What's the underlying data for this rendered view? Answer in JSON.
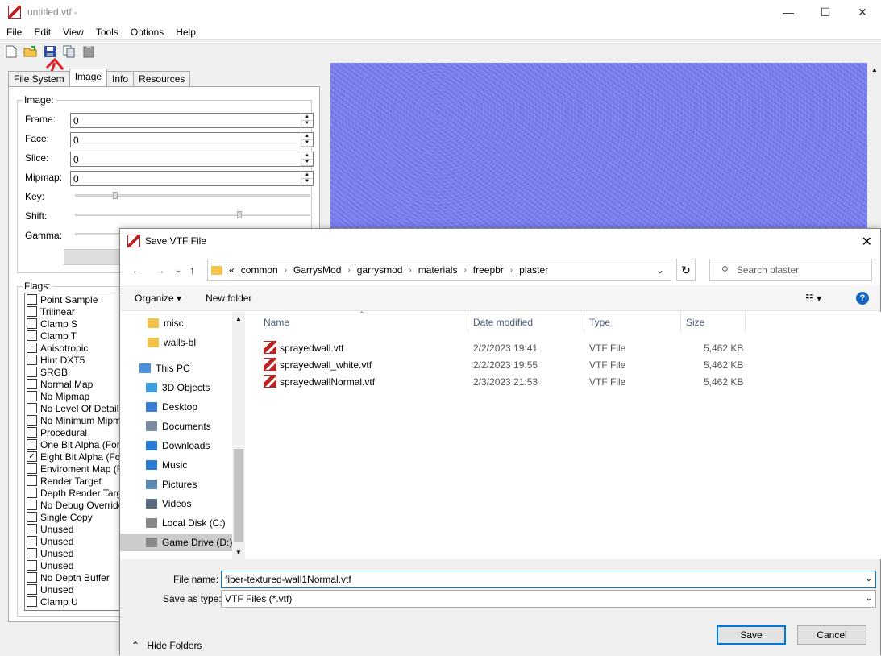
{
  "window": {
    "title": "untitled.vtf -",
    "controls": [
      "—",
      "☐",
      "✕"
    ]
  },
  "menu": [
    "File",
    "Edit",
    "View",
    "Tools",
    "Options",
    "Help"
  ],
  "tabs": [
    "File System",
    "Image",
    "Info",
    "Resources"
  ],
  "image_group": {
    "label": "Image:",
    "fields": [
      {
        "label": "Frame:",
        "value": "0"
      },
      {
        "label": "Face:",
        "value": "0"
      },
      {
        "label": "Slice:",
        "value": "0"
      },
      {
        "label": "Mipmap:",
        "value": "0"
      }
    ],
    "sliders": [
      {
        "label": "Key:",
        "level": 0.16
      },
      {
        "label": "Shift:",
        "level": 0.7
      },
      {
        "label": "Gamma:",
        "level": 0.2
      }
    ]
  },
  "flags": {
    "label": "Flags:",
    "items": [
      {
        "label": "Point Sample",
        "checked": false
      },
      {
        "label": "Trilinear",
        "checked": false
      },
      {
        "label": "Clamp S",
        "checked": false
      },
      {
        "label": "Clamp T",
        "checked": false
      },
      {
        "label": "Anisotropic",
        "checked": false
      },
      {
        "label": "Hint DXT5",
        "checked": false
      },
      {
        "label": "SRGB",
        "checked": false
      },
      {
        "label": "Normal Map",
        "checked": false
      },
      {
        "label": "No Mipmap",
        "checked": false
      },
      {
        "label": "No Level Of Detail",
        "checked": false
      },
      {
        "label": "No Minimum Mipmap",
        "checked": false
      },
      {
        "label": "Procedural",
        "checked": false
      },
      {
        "label": "One Bit Alpha (Format)",
        "checked": false
      },
      {
        "label": "Eight Bit Alpha (Format)",
        "checked": true
      },
      {
        "label": "Enviroment Map (Format)",
        "checked": false
      },
      {
        "label": "Render Target",
        "checked": false
      },
      {
        "label": "Depth Render Target",
        "checked": false
      },
      {
        "label": "No Debug Override",
        "checked": false
      },
      {
        "label": "Single Copy",
        "checked": false
      },
      {
        "label": "Unused",
        "checked": false
      },
      {
        "label": "Unused",
        "checked": false
      },
      {
        "label": "Unused",
        "checked": false
      },
      {
        "label": "Unused",
        "checked": false
      },
      {
        "label": "No Depth Buffer",
        "checked": false
      },
      {
        "label": "Unused",
        "checked": false
      },
      {
        "label": "Clamp U",
        "checked": false
      }
    ]
  },
  "dialog": {
    "title": "Save VTF File",
    "breadcrumb": [
      "«",
      "common",
      "GarrysMod",
      "garrysmod",
      "materials",
      "freepbr",
      "plaster"
    ],
    "search_placeholder": "Search plaster",
    "organize": "Organize ▾",
    "new_folder": "New folder",
    "nav": [
      {
        "label": "misc",
        "icon": "folder-icon"
      },
      {
        "label": "walls-bl",
        "icon": "folder-icon"
      },
      {
        "label": "This PC",
        "icon": "computer-icon"
      },
      {
        "label": "3D Objects",
        "icon": "cube-icon"
      },
      {
        "label": "Desktop",
        "icon": "desktop-icon"
      },
      {
        "label": "Documents",
        "icon": "documents-icon"
      },
      {
        "label": "Downloads",
        "icon": "download-icon"
      },
      {
        "label": "Music",
        "icon": "music-icon"
      },
      {
        "label": "Pictures",
        "icon": "pictures-icon"
      },
      {
        "label": "Videos",
        "icon": "videos-icon"
      },
      {
        "label": "Local Disk (C:)",
        "icon": "drive-icon"
      },
      {
        "label": "Game Drive (D:)",
        "icon": "drive-icon"
      }
    ],
    "columns": [
      "Name",
      "Date modified",
      "Type",
      "Size"
    ],
    "files": [
      {
        "name": "sprayedwall.vtf",
        "date": "2/2/2023 19:41",
        "type": "VTF File",
        "size": "5,462 KB"
      },
      {
        "name": "sprayedwall_white.vtf",
        "date": "2/2/2023 19:55",
        "type": "VTF File",
        "size": "5,462 KB"
      },
      {
        "name": "sprayedwallNormal.vtf",
        "date": "2/3/2023 21:53",
        "type": "VTF File",
        "size": "5,462 KB"
      }
    ],
    "file_name_label": "File name:",
    "file_name_value": "fiber-textured-wall1Normal.vtf",
    "save_type_label": "Save as type:",
    "save_type_value": "VTF Files (*.vtf)",
    "save_label": "Save",
    "cancel_label": "Cancel",
    "hide_folders": "Hide Folders"
  },
  "colors": {
    "accent": "#0078d7",
    "preview": "#7f7ff0",
    "annotation": "#e02020"
  }
}
